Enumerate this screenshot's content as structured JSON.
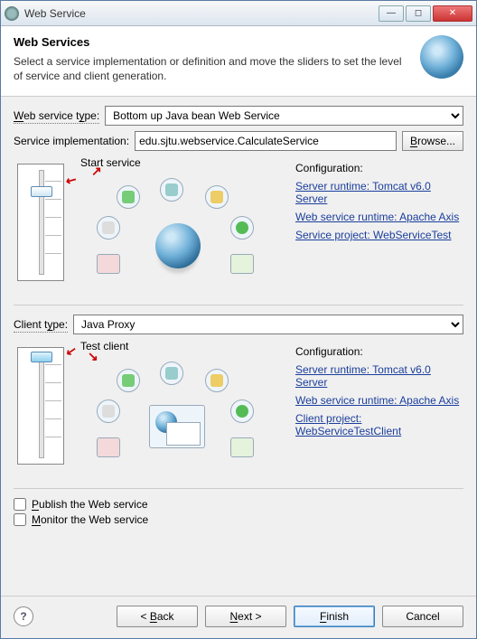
{
  "window": {
    "title": "Web Service"
  },
  "header": {
    "title": "Web Services",
    "desc": "Select a service implementation or definition and move the sliders to set the level of service and client generation."
  },
  "service": {
    "type_label": "Web service type:",
    "type_value": "Bottom up Java bean Web Service",
    "impl_label": "Service implementation:",
    "impl_value": "edu.sjtu.webservice.CalculateService",
    "browse": "Browse...",
    "slider_annot": "Start service",
    "cfg_title": "Configuration:",
    "links": {
      "server": "Server runtime: Tomcat v6.0 Server",
      "ws_runtime": "Web service runtime: Apache Axis",
      "project": "Service project: WebServiceTest"
    }
  },
  "client": {
    "type_label": "Client type:",
    "type_value": "Java Proxy",
    "slider_annot": "Test client",
    "cfg_title": "Configuration:",
    "links": {
      "server": "Server runtime: Tomcat v6.0 Server",
      "ws_runtime": "Web service runtime: Apache Axis",
      "project": "Client project: WebServiceTestClient"
    }
  },
  "options": {
    "publish": "Publish the Web service",
    "monitor": "Monitor the Web service"
  },
  "footer": {
    "back": "< Back",
    "next": "Next >",
    "finish": "Finish",
    "cancel": "Cancel"
  }
}
